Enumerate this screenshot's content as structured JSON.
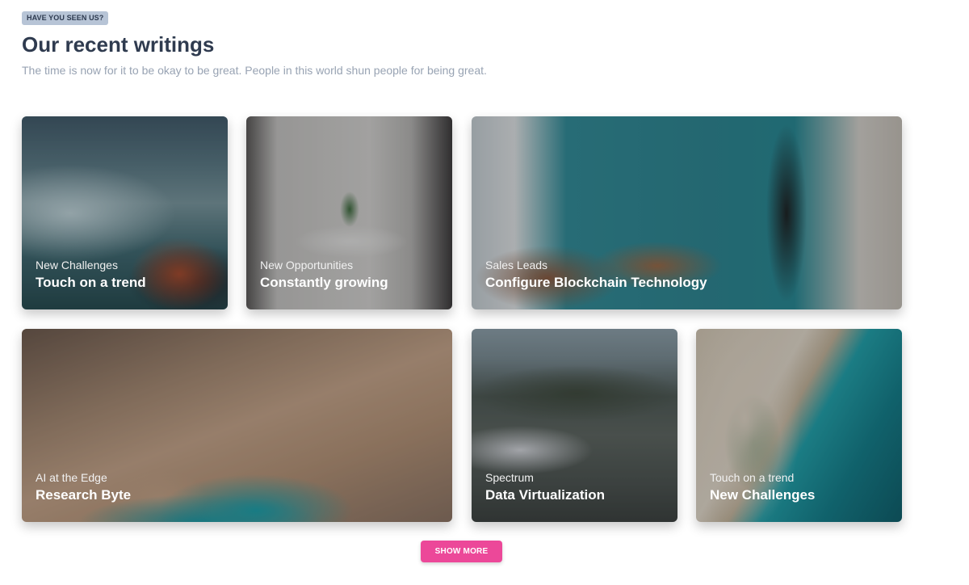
{
  "header": {
    "badge": "HAVE YOU SEEN US?",
    "title": "Our recent writings",
    "subtitle": "The time is now for it to be okay to be great. People in this world shun people for being great."
  },
  "cards": [
    {
      "category": "New Challenges",
      "title": "Touch on a trend"
    },
    {
      "category": "New Opportunities",
      "title": "Constantly growing"
    },
    {
      "category": "Sales Leads",
      "title": "Configure Blockchain Technology"
    },
    {
      "category": "AI at the Edge",
      "title": "Research Byte"
    },
    {
      "category": "Spectrum",
      "title": "Data Virtualization"
    },
    {
      "category": "Touch on a trend",
      "title": "New Challenges"
    }
  ],
  "actions": {
    "show_more": "SHOW MORE"
  },
  "colors": {
    "badge_bg": "#b7c4d6",
    "title": "#2f3b4f",
    "subtitle": "#98a3b3",
    "button": "#ec4899"
  }
}
